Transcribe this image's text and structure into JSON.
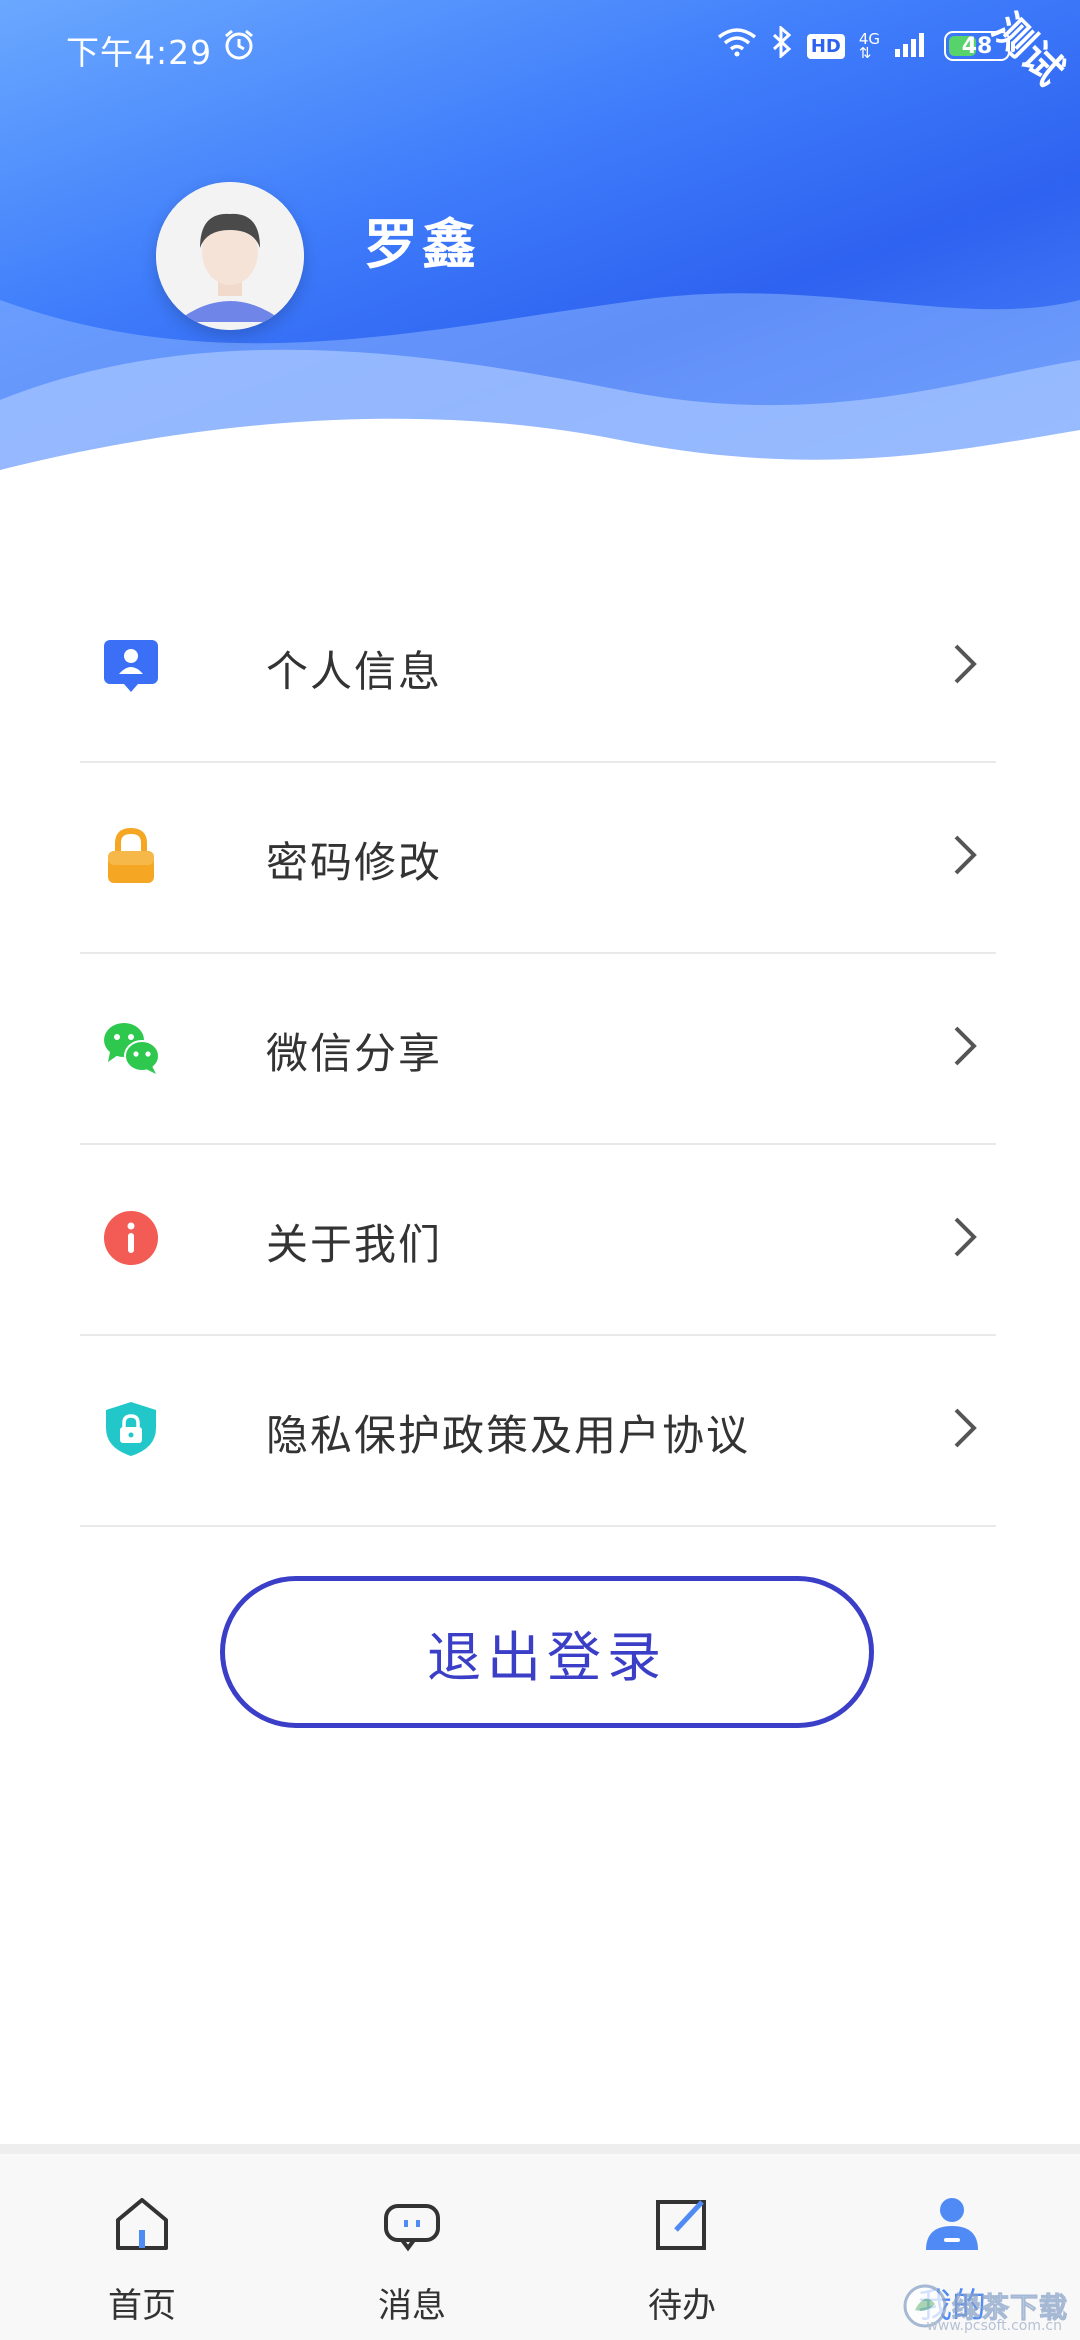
{
  "status_bar": {
    "time": "下午4:29",
    "network": "4G",
    "hd": "HD",
    "battery": "48",
    "battery_level": 0.48
  },
  "corner_ribbon": "测试",
  "profile": {
    "name": "罗鑫"
  },
  "menu": [
    {
      "label": "个人信息",
      "icon": "user-card-icon",
      "color": "#3b6ff5"
    },
    {
      "label": "密码修改",
      "icon": "lock-icon",
      "color": "#f5a623"
    },
    {
      "label": "微信分享",
      "icon": "wechat-icon",
      "color": "#2dc84d"
    },
    {
      "label": "关于我们",
      "icon": "info-icon",
      "color": "#f25c54"
    },
    {
      "label": "隐私保护政策及用户协议",
      "icon": "shield-lock-icon",
      "color": "#22c7c9"
    }
  ],
  "logout_label": "退出登录",
  "tabs": [
    {
      "label": "首页",
      "icon": "home-icon"
    },
    {
      "label": "消息",
      "icon": "message-icon"
    },
    {
      "label": "待办",
      "icon": "todo-edit-icon"
    },
    {
      "label": "我的",
      "icon": "profile-icon",
      "active": true
    }
  ],
  "watermark": {
    "text": "绿茶下载",
    "sub": "www.pcsoft.com.cn"
  },
  "colors": {
    "accent": "#3b3fc7",
    "tab_active": "#4f8af5",
    "header_blue": "#3f7dfb"
  }
}
